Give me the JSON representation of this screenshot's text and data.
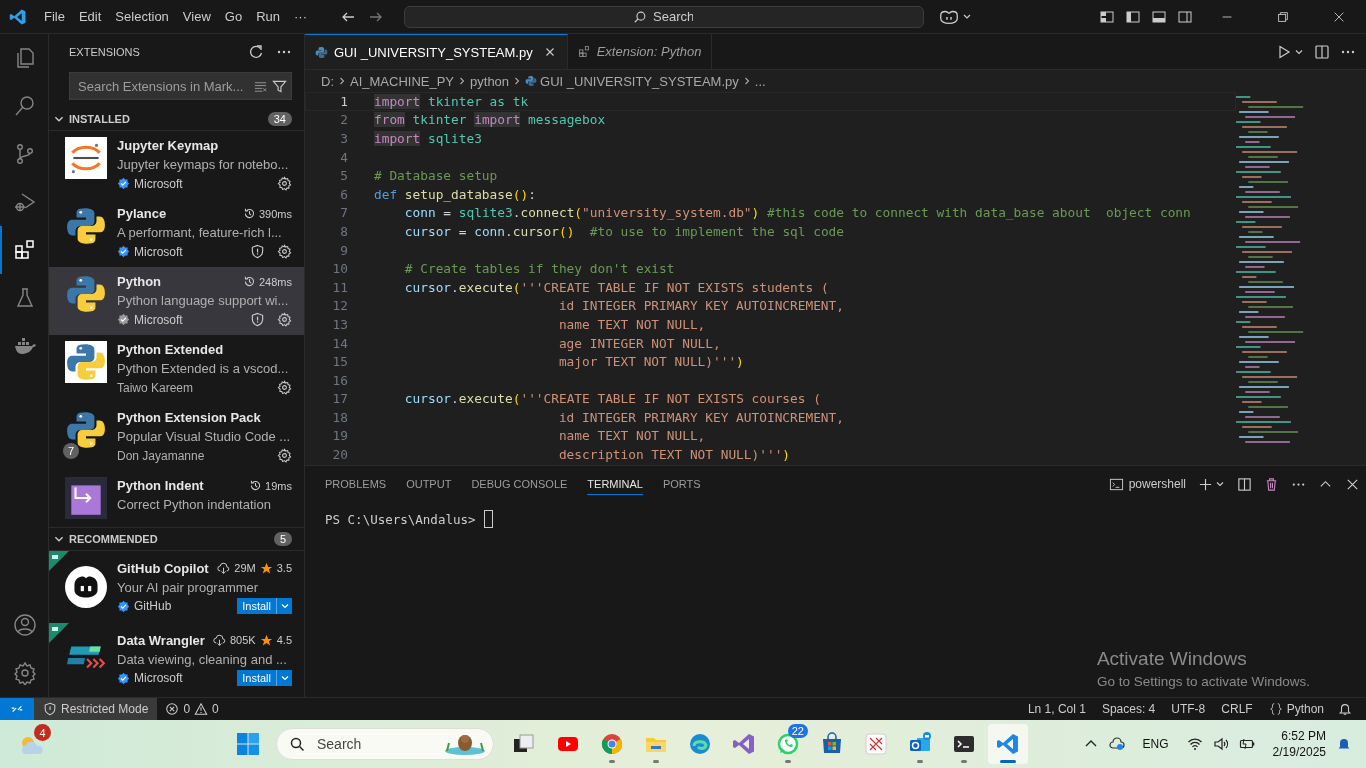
{
  "menu": [
    "File",
    "Edit",
    "Selection",
    "View",
    "Go",
    "Run",
    "···"
  ],
  "command_search": {
    "placeholder": "Search"
  },
  "activity_bar": [
    {
      "kind": "explorer",
      "selected": false
    },
    {
      "kind": "search",
      "selected": false
    },
    {
      "kind": "source-control",
      "selected": false
    },
    {
      "kind": "run-debug",
      "selected": false
    },
    {
      "kind": "extensions",
      "selected": true
    },
    {
      "kind": "testing",
      "selected": false
    },
    {
      "kind": "docker",
      "selected": false
    }
  ],
  "activity_bar_bottom": [
    {
      "kind": "account"
    },
    {
      "kind": "settings"
    }
  ],
  "sidebar": {
    "title": "EXTENSIONS",
    "search": {
      "placeholder": "Search Extensions in Mark..."
    },
    "installed": {
      "label": "INSTALLED",
      "count": "34",
      "expanded": true,
      "items": [
        {
          "name": "Jupyter Keymap",
          "description": "Jupyter keymaps for notebo...",
          "publisher": "Microsoft",
          "verified": true,
          "shield": false,
          "settings": true,
          "selected": false,
          "kind": "jupyter"
        },
        {
          "name": "Pylance",
          "time": "390ms",
          "description": "A performant, feature-rich l...",
          "publisher": "Microsoft",
          "verified": true,
          "shield": true,
          "settings": true,
          "selected": false,
          "kind": "python"
        },
        {
          "name": "Python",
          "time": "248ms",
          "description": "Python language support wi...",
          "publisher": "Microsoft",
          "verified": true,
          "shield": true,
          "settings": true,
          "selected": true,
          "kind": "python"
        },
        {
          "name": "Python Extended",
          "description": "Python Extended is a vscod...",
          "publisher": "Taiwo Kareem",
          "verified": false,
          "shield": false,
          "settings": true,
          "selected": false,
          "kind": "python-boxed"
        },
        {
          "name": "Python Extension Pack",
          "description": "Popular Visual Studio Code ...",
          "publisher": "Don Jayamanne",
          "verified": false,
          "shield": false,
          "settings": true,
          "selected": false,
          "kind": "python",
          "badge": "7"
        },
        {
          "name": "Python Indent",
          "time": "19ms",
          "description": "Correct Python indentation",
          "selected": false,
          "kind": "indent"
        }
      ]
    },
    "recommended": {
      "label": "RECOMMENDED",
      "count": "5",
      "expanded": true,
      "items": [
        {
          "name": "GitHub Copilot",
          "downloads": "29M",
          "rating": "3.5",
          "description": "Your AI pair programmer",
          "publisher": "GitHub",
          "verified": true,
          "action": "Install",
          "kind": "copilot"
        },
        {
          "name": "Data Wrangler",
          "downloads": "805K",
          "rating": "4.5",
          "description": "Data viewing, cleaning and ...",
          "publisher": "Microsoft",
          "verified": true,
          "action": "Install",
          "kind": "wrangler"
        }
      ]
    }
  },
  "editor": {
    "tabs": [
      {
        "label": "GUI _UNIVERSITY_SYSTEAM.py",
        "kind": "file",
        "selected": true
      },
      {
        "label": "Extension: Python",
        "kind": "extension",
        "selected": false
      }
    ],
    "breadcrumb": [
      {
        "text": "D:",
        "kind": "folder"
      },
      {
        "text": "AI_MACHINE_PY",
        "kind": "folder"
      },
      {
        "text": "python",
        "kind": "folder"
      },
      {
        "text": "GUI _UNIVERSITY_SYSTEAM.py",
        "kind": "file"
      },
      {
        "text": "...",
        "kind": "more"
      }
    ],
    "lines": [
      {
        "number": "1",
        "current": true,
        "tokens": [
          {
            "text": "import",
            "kind": "kw"
          },
          {
            "text": " tkinter as tk",
            "kind": "mod"
          }
        ]
      },
      {
        "number": "2",
        "current": false,
        "tokens": [
          {
            "text": "from",
            "kind": "kw"
          },
          {
            "text": " tkinter ",
            "kind": "mod"
          },
          {
            "text": "import",
            "kind": "kw"
          },
          {
            "text": " messagebox",
            "kind": "mod"
          }
        ]
      },
      {
        "number": "3",
        "current": false,
        "tokens": [
          {
            "text": "import",
            "kind": "kw"
          },
          {
            "text": " sqlite3",
            "kind": "mod"
          }
        ]
      },
      {
        "number": "4",
        "current": false
      },
      {
        "number": "5",
        "current": false,
        "tokens": [
          {
            "text": "# Database setup",
            "kind": "cmt"
          }
        ]
      },
      {
        "number": "6",
        "current": false,
        "tokens": [
          {
            "text": "def",
            "kind": "def"
          },
          {
            "text": " setup_database",
            "kind": "fn"
          },
          {
            "text": "()",
            "kind": "br"
          },
          {
            "text": ":",
            "kind": "p"
          }
        ]
      },
      {
        "number": "7",
        "current": false,
        "tokens": [
          {
            "text": "    conn",
            "kind": "var"
          },
          {
            "text": " = ",
            "kind": "p"
          },
          {
            "text": "sqlite3",
            "kind": "mod"
          },
          {
            "text": ".",
            "kind": "p"
          },
          {
            "text": "connect",
            "kind": "fn"
          },
          {
            "text": "(",
            "kind": "br"
          },
          {
            "text": "\"university_system.db\"",
            "kind": "str"
          },
          {
            "text": ")",
            "kind": "br"
          },
          {
            "text": " #this code to connect with data_base about  object conn",
            "kind": "cmt"
          }
        ]
      },
      {
        "number": "8",
        "current": false,
        "tokens": [
          {
            "text": "    cursor",
            "kind": "var"
          },
          {
            "text": " = ",
            "kind": "p"
          },
          {
            "text": "conn",
            "kind": "var"
          },
          {
            "text": ".",
            "kind": "p"
          },
          {
            "text": "cursor",
            "kind": "fn"
          },
          {
            "text": "()",
            "kind": "br"
          },
          {
            "text": "  #to use to implement the sql code",
            "kind": "cmt"
          }
        ]
      },
      {
        "number": "9",
        "current": false
      },
      {
        "number": "10",
        "current": false,
        "tokens": [
          {
            "text": "    # Create tables if they don't exist",
            "kind": "cmt"
          }
        ]
      },
      {
        "number": "11",
        "current": false,
        "tokens": [
          {
            "text": "    cursor",
            "kind": "var"
          },
          {
            "text": ".",
            "kind": "p"
          },
          {
            "text": "execute",
            "kind": "fn"
          },
          {
            "text": "(",
            "kind": "br"
          },
          {
            "text": "'''CREATE TABLE IF NOT EXISTS students (",
            "kind": "str"
          }
        ]
      },
      {
        "number": "12",
        "current": false,
        "tokens": [
          {
            "text": "                        id INTEGER PRIMARY KEY AUTOINCREMENT,",
            "kind": "str"
          }
        ]
      },
      {
        "number": "13",
        "current": false,
        "tokens": [
          {
            "text": "                        name TEXT NOT NULL,",
            "kind": "str"
          }
        ]
      },
      {
        "number": "14",
        "current": false,
        "tokens": [
          {
            "text": "                        age INTEGER NOT NULL,",
            "kind": "str"
          }
        ]
      },
      {
        "number": "15",
        "current": false,
        "tokens": [
          {
            "text": "                        major TEXT NOT NULL)'''",
            "kind": "str"
          },
          {
            "text": ")",
            "kind": "br"
          }
        ]
      },
      {
        "number": "16",
        "current": false
      },
      {
        "number": "17",
        "current": false,
        "tokens": [
          {
            "text": "    cursor",
            "kind": "var"
          },
          {
            "text": ".",
            "kind": "p"
          },
          {
            "text": "execute",
            "kind": "fn"
          },
          {
            "text": "(",
            "kind": "br"
          },
          {
            "text": "'''CREATE TABLE IF NOT EXISTS courses (",
            "kind": "str"
          }
        ]
      },
      {
        "number": "18",
        "current": false,
        "tokens": [
          {
            "text": "                        id INTEGER PRIMARY KEY AUTOINCREMENT,",
            "kind": "str"
          }
        ]
      },
      {
        "number": "19",
        "current": false,
        "tokens": [
          {
            "text": "                        name TEXT NOT NULL,",
            "kind": "str"
          }
        ]
      },
      {
        "number": "20",
        "current": false,
        "tokens": [
          {
            "text": "                        description TEXT NOT NULL)'''",
            "kind": "str"
          },
          {
            "text": ")",
            "kind": "br"
          }
        ]
      }
    ]
  },
  "panel": {
    "tabs": [
      {
        "label": "PROBLEMS",
        "selected": false
      },
      {
        "label": "OUTPUT",
        "selected": false
      },
      {
        "label": "DEBUG CONSOLE",
        "selected": false
      },
      {
        "label": "TERMINAL",
        "selected": true
      },
      {
        "label": "PORTS",
        "selected": false
      }
    ],
    "shell": "powershell",
    "prompt": "PS C:\\Users\\Andalus>"
  },
  "activation": {
    "title": "Activate Windows",
    "subtitle": "Go to Settings to activate Windows."
  },
  "status_bar": {
    "restricted": "Restricted Mode",
    "errors": "0",
    "warnings": "0",
    "right": [
      {
        "text": "Ln 1, Col 1",
        "kind": "text"
      },
      {
        "text": "Spaces: 4",
        "kind": "text"
      },
      {
        "text": "UTF-8",
        "kind": "text"
      },
      {
        "text": "CRLF",
        "kind": "text"
      },
      {
        "text": "Python",
        "kind": "language"
      }
    ]
  },
  "taskbar": {
    "weather_badge": "4",
    "search": {
      "placeholder": "Search"
    },
    "apps": [
      {
        "kind": "taskview",
        "running": false,
        "selected": false
      },
      {
        "kind": "youtube",
        "running": false,
        "selected": false
      },
      {
        "kind": "chrome",
        "running": true,
        "selected": false
      },
      {
        "kind": "files",
        "running": true,
        "selected": false
      },
      {
        "kind": "edge",
        "running": false,
        "selected": false
      },
      {
        "kind": "visualstudio",
        "running": false,
        "selected": false
      },
      {
        "kind": "whatsapp",
        "running": true,
        "selected": false,
        "badge": "22"
      },
      {
        "kind": "store",
        "running": false,
        "selected": false
      },
      {
        "kind": "sketch",
        "running": false,
        "selected": false
      },
      {
        "kind": "outlook",
        "running": true,
        "selected": false
      },
      {
        "kind": "terminal",
        "running": true,
        "selected": false
      },
      {
        "kind": "vscode",
        "running": true,
        "selected": true
      }
    ],
    "language": "ENG",
    "time": "6:52 PM",
    "date": "2/19/2025"
  }
}
